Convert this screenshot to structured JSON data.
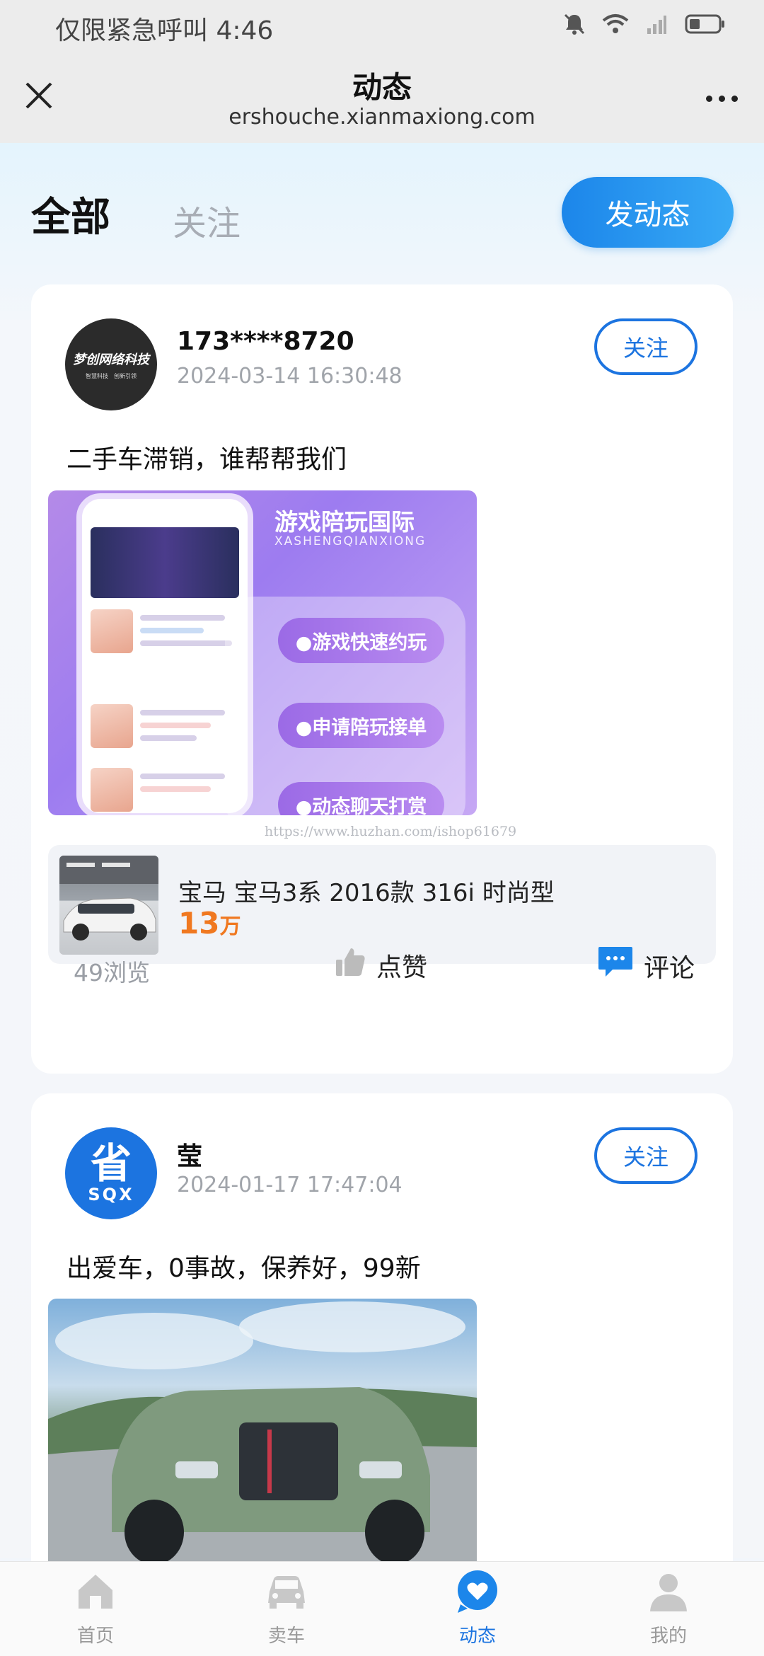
{
  "status_bar": {
    "carrier_time": "仅限紧急呼叫 4:46"
  },
  "header": {
    "title": "动态",
    "url": "ershouche.xianmaxiong.com"
  },
  "tabs": {
    "all": "全部",
    "follow": "关注"
  },
  "post_button": "发动态",
  "posts": [
    {
      "avatar_text": "梦创网络科技",
      "avatar_sub": "智慧科技　创新引领",
      "username": "173****8720",
      "time": "2024-03-14 16:30:48",
      "follow": "关注",
      "text": "二手车滞销，谁帮帮我们",
      "image": {
        "title": "游戏陪玩国际",
        "subtitle": "XASHENGQIANXIONG",
        "pills": [
          "●游戏快速约玩",
          "●申请陪玩接单",
          "●动态聊天打赏"
        ]
      },
      "watermark": "https://www.huzhan.com/ishop61679",
      "car": {
        "name": "宝马 宝马3系 2016款 316i 时尚型",
        "price": "13",
        "unit": "万"
      },
      "views": "49浏览",
      "like": "点赞",
      "comment": "评论"
    },
    {
      "avatar_text": "省",
      "avatar_sub": "SQX",
      "username": "莹",
      "time": "2024-01-17 17:47:04",
      "follow": "关注",
      "text": "出爱车，0事故，保养好，99新"
    }
  ],
  "nav": [
    {
      "label": "首页",
      "icon": "home-icon"
    },
    {
      "label": "卖车",
      "icon": "car-icon"
    },
    {
      "label": "动态",
      "icon": "heart-chat-icon",
      "active": true
    },
    {
      "label": "我的",
      "icon": "user-icon"
    }
  ],
  "colors": {
    "accent": "#1c74e0",
    "price": "#f07820"
  }
}
